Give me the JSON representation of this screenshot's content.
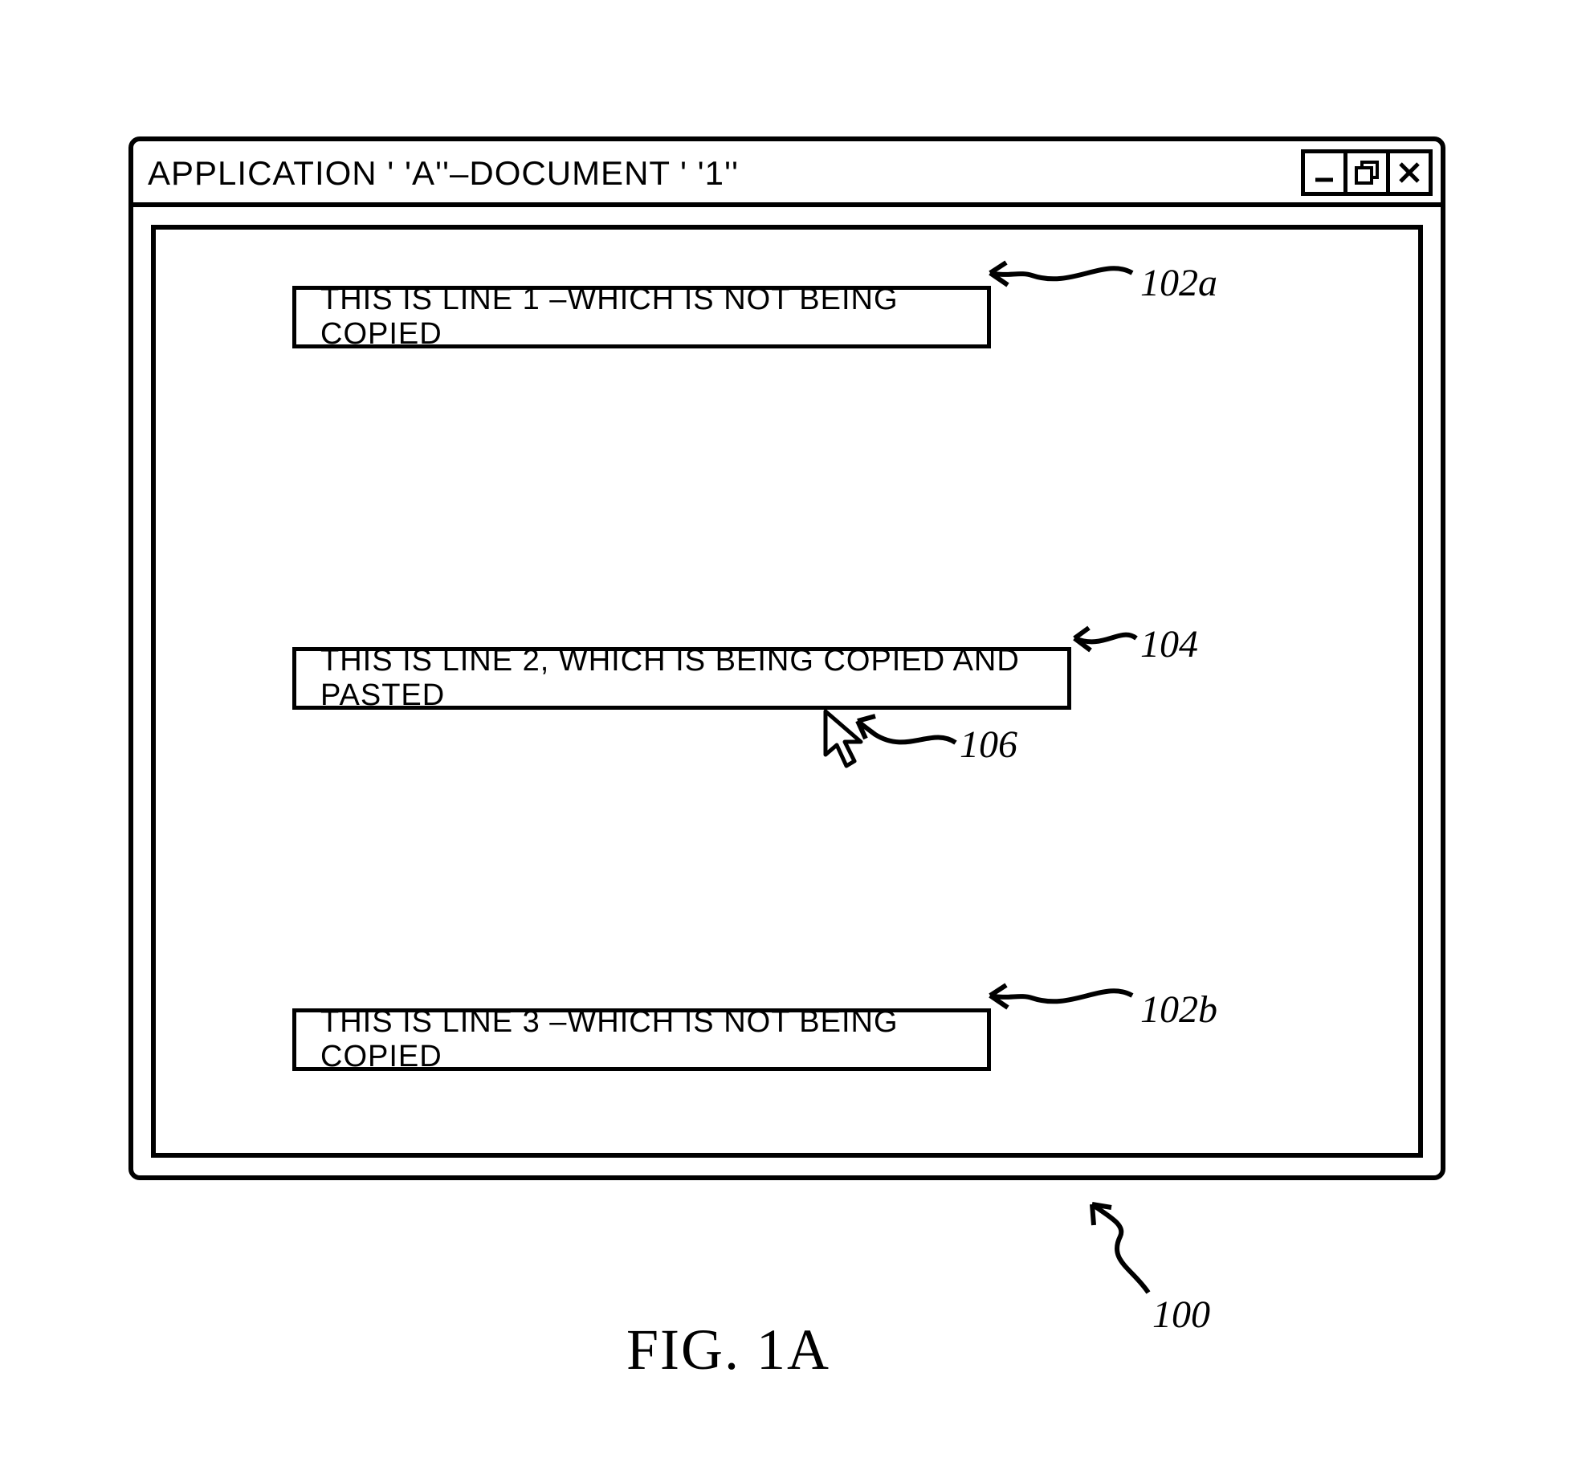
{
  "window": {
    "title": "APPLICATION ' 'A''–DOCUMENT ' '1''"
  },
  "lines": {
    "line1": "THIS IS LINE 1 –WHICH IS NOT BEING COPIED",
    "line2": "THIS IS LINE 2, WHICH IS BEING COPIED AND PASTED",
    "line3": "THIS IS LINE 3 –WHICH IS NOT BEING COPIED"
  },
  "callouts": {
    "l102a": "102a",
    "l104": "104",
    "l106": "106",
    "l102b": "102b",
    "l100": "100"
  },
  "figure_caption": "FIG. 1A"
}
